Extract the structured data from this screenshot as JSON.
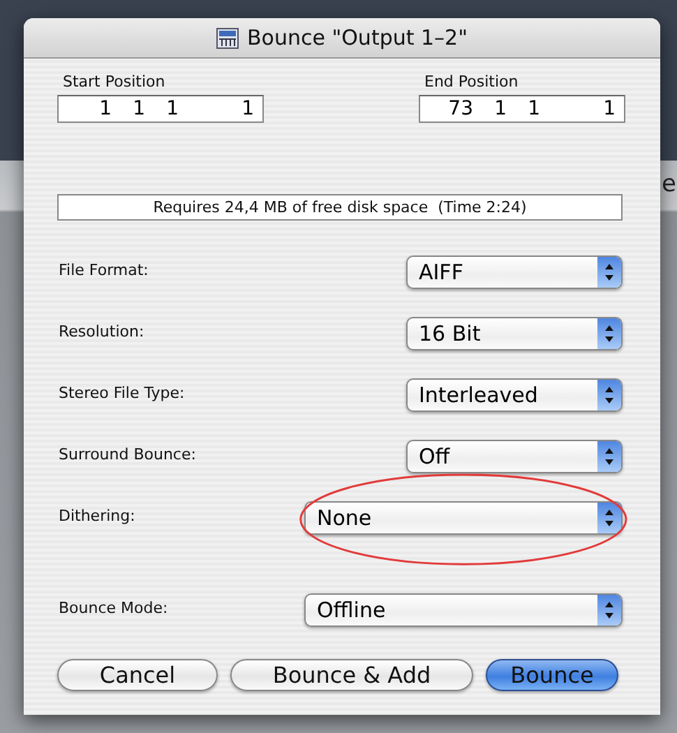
{
  "background_text": "e",
  "window": {
    "title": "Bounce \"Output 1–2\""
  },
  "positions": [
    {
      "label": "Start Position",
      "values": [
        "1",
        "1",
        "1",
        "1"
      ]
    },
    {
      "label": "End Position",
      "values": [
        "73",
        "1",
        "1",
        "1"
      ]
    }
  ],
  "info": "Requires 24,4 MB of free disk space  (Time 2:24)",
  "settings": [
    {
      "label": "File Format:",
      "value": "AIFF",
      "highlighted": false
    },
    {
      "label": "Resolution:",
      "value": "16 Bit",
      "highlighted": false
    },
    {
      "label": "Stereo File Type:",
      "value": "Interleaved",
      "highlighted": false
    },
    {
      "label": "Surround Bounce:",
      "value": "Off",
      "highlighted": false
    },
    {
      "label": "Dithering:",
      "value": "None",
      "highlighted": true
    },
    {
      "label": "Bounce Mode:",
      "value": "Offline",
      "highlighted": false
    }
  ],
  "buttons": [
    {
      "label": "Cancel",
      "default": false
    },
    {
      "label": "Bounce & Add",
      "default": false
    },
    {
      "label": "Bounce",
      "default": true
    }
  ]
}
